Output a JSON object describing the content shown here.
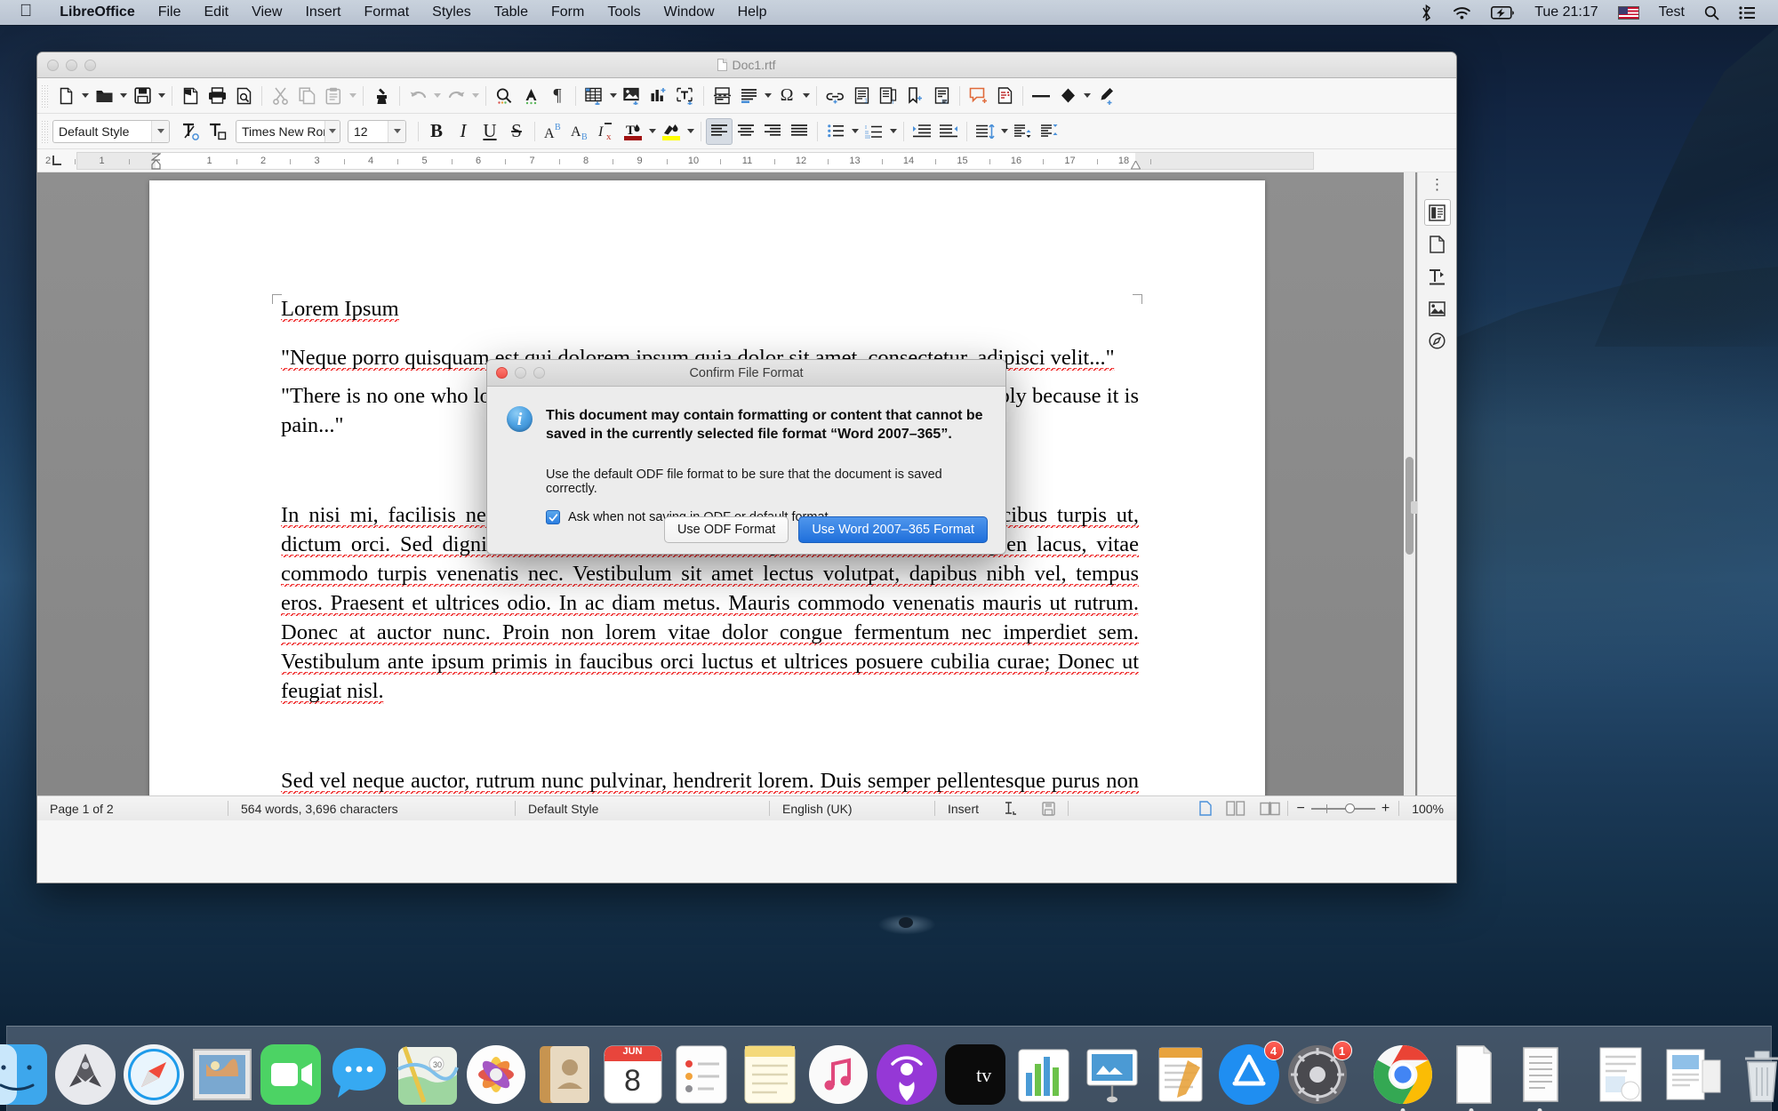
{
  "menubar": {
    "apple_icon": "apple-logo-icon",
    "items": [
      {
        "label": "LibreOffice",
        "bold": true
      },
      {
        "label": "File"
      },
      {
        "label": "Edit"
      },
      {
        "label": "View"
      },
      {
        "label": "Insert"
      },
      {
        "label": "Format"
      },
      {
        "label": "Styles"
      },
      {
        "label": "Table"
      },
      {
        "label": "Form"
      },
      {
        "label": "Tools"
      },
      {
        "label": "Window"
      },
      {
        "label": "Help"
      }
    ],
    "status": {
      "bluetooth_icon": "bluetooth-icon",
      "wifi_icon": "wifi-icon",
      "battery_icon": "battery-charging-icon",
      "clock": "Tue 21:17",
      "flag_icon": "us-flag-icon",
      "user": "Test",
      "search_icon": "spotlight-search-icon",
      "control_center_icon": "control-center-icon"
    }
  },
  "window": {
    "title": "Doc1.rtf",
    "file_icon": "rtf-document-icon"
  },
  "standard_toolbar": [
    {
      "name": "new-document",
      "icon": "new-doc-icon",
      "dropdown": true,
      "dim": false
    },
    {
      "name": "open-document",
      "icon": "open-folder-icon",
      "dropdown": true,
      "dim": false
    },
    {
      "name": "save-document",
      "icon": "save-floppy-icon",
      "dropdown": true,
      "dim": false
    },
    {
      "sep": true
    },
    {
      "name": "export-pdf",
      "icon": "export-pdf-icon",
      "dim": false
    },
    {
      "name": "print",
      "icon": "printer-icon",
      "dim": false
    },
    {
      "name": "print-preview",
      "icon": "print-preview-icon",
      "dim": false
    },
    {
      "sep": true
    },
    {
      "name": "cut",
      "icon": "scissors-icon",
      "dim": true
    },
    {
      "name": "copy",
      "icon": "copy-icon",
      "dim": true
    },
    {
      "name": "paste",
      "icon": "clipboard-icon",
      "dropdown": true,
      "dim": true
    },
    {
      "sep": true
    },
    {
      "name": "clone-formatting",
      "icon": "paintbrush-clone-icon",
      "dim": false
    },
    {
      "sep": true
    },
    {
      "name": "undo",
      "icon": "undo-arrow-icon",
      "dropdown": true,
      "dim": true
    },
    {
      "name": "redo",
      "icon": "redo-arrow-icon",
      "dropdown": true,
      "dim": true
    },
    {
      "sep": true
    },
    {
      "name": "find-and-replace",
      "icon": "magnifier-icon",
      "dim": false
    },
    {
      "name": "spelling",
      "icon": "spellcheck-abc-icon",
      "dim": false
    },
    {
      "name": "formatting-marks",
      "icon": "pilcrow-icon",
      "dim": false
    },
    {
      "sep": true
    },
    {
      "name": "insert-table",
      "icon": "table-grid-icon",
      "dropdown": true,
      "dim": false
    },
    {
      "name": "insert-image",
      "icon": "image-icon",
      "dim": false
    },
    {
      "name": "insert-chart",
      "icon": "bar-chart-icon",
      "dim": false
    },
    {
      "name": "insert-text-box",
      "icon": "text-box-icon",
      "dim": false
    },
    {
      "sep": true
    },
    {
      "name": "insert-page-break",
      "icon": "page-break-icon",
      "dim": false
    },
    {
      "name": "insert-field",
      "icon": "field-lines-icon",
      "dropdown": true,
      "dim": false
    },
    {
      "name": "insert-special-character",
      "icon": "omega-icon",
      "dropdown": true,
      "dim": false
    },
    {
      "sep": true
    },
    {
      "name": "insert-hyperlink",
      "icon": "hyperlink-icon",
      "dim": false
    },
    {
      "name": "insert-footnote",
      "icon": "footnote-icon",
      "dim": false
    },
    {
      "name": "insert-endnote",
      "icon": "endnote-icon",
      "dim": false
    },
    {
      "name": "insert-bookmark",
      "icon": "bookmark-icon",
      "dim": false
    },
    {
      "name": "insert-cross-reference",
      "icon": "cross-reference-icon",
      "dim": false
    },
    {
      "sep": true
    },
    {
      "name": "insert-comment",
      "icon": "comment-icon",
      "dim": false
    },
    {
      "name": "track-changes",
      "icon": "track-changes-icon",
      "dim": false
    },
    {
      "sep": true
    },
    {
      "name": "insert-line",
      "icon": "line-icon",
      "dim": false
    },
    {
      "name": "basic-shapes",
      "icon": "shapes-diamond-icon",
      "dropdown": true,
      "dim": false
    },
    {
      "name": "show-draw-functions",
      "icon": "draw-brush-icon",
      "dim": false
    }
  ],
  "formatting_toolbar": {
    "paragraph_style": {
      "value": "Default Style",
      "placeholder": "Paragraph Style"
    },
    "font_name": {
      "value": "Times New Rom",
      "placeholder": "Font Name"
    },
    "font_size": {
      "value": "12",
      "placeholder": "Font Size"
    },
    "buttons": [
      {
        "name": "update-selected-style",
        "icon": "update-style-icon"
      },
      {
        "name": "new-style-from-selection",
        "icon": "new-style-icon"
      },
      {
        "name": "bold",
        "icon": "bold-icon",
        "glyph": "B"
      },
      {
        "name": "italic",
        "icon": "italic-icon",
        "glyph": "I"
      },
      {
        "name": "underline",
        "icon": "underline-icon",
        "glyph": "U"
      },
      {
        "name": "strikethrough",
        "icon": "strikethrough-icon",
        "glyph": "S"
      },
      {
        "name": "superscript",
        "icon": "superscript-icon"
      },
      {
        "name": "subscript",
        "icon": "subscript-icon"
      },
      {
        "name": "clear-formatting",
        "icon": "clear-formatting-icon"
      },
      {
        "name": "font-color",
        "icon": "font-color-icon",
        "color": "#a01010"
      },
      {
        "name": "highlight-color",
        "icon": "highlight-color-icon",
        "color": "#ffff00"
      },
      {
        "name": "align-left",
        "icon": "align-left-icon",
        "active": true
      },
      {
        "name": "align-center",
        "icon": "align-center-icon"
      },
      {
        "name": "align-right",
        "icon": "align-right-icon"
      },
      {
        "name": "justified",
        "icon": "align-justify-icon"
      },
      {
        "name": "unordered-list",
        "icon": "bullet-list-icon"
      },
      {
        "name": "ordered-list",
        "icon": "numbered-list-icon"
      },
      {
        "name": "increase-indent",
        "icon": "increase-indent-icon"
      },
      {
        "name": "decrease-indent",
        "icon": "decrease-indent-icon"
      },
      {
        "name": "line-spacing",
        "icon": "line-spacing-icon"
      },
      {
        "name": "paragraph-space-above",
        "icon": "space-above-paragraph-icon"
      },
      {
        "name": "paragraph-space-below",
        "icon": "space-below-paragraph-icon"
      }
    ]
  },
  "ruler": {
    "corner_icon": "tab-stop-left-icon",
    "labels": [
      "2",
      "1",
      "1",
      "2",
      "3",
      "4",
      "5",
      "6",
      "7",
      "8",
      "9",
      "10",
      "11",
      "12",
      "13",
      "14",
      "15",
      "16",
      "17",
      "18"
    ]
  },
  "sidebar_rail": {
    "more_icon": "sidebar-settings-dots-icon",
    "items": [
      {
        "name": "sidebar-properties",
        "icon": "properties-panel-icon",
        "selected": true
      },
      {
        "name": "sidebar-page",
        "icon": "page-panel-icon"
      },
      {
        "name": "sidebar-styles",
        "icon": "styles-panel-icon"
      },
      {
        "name": "sidebar-gallery",
        "icon": "gallery-panel-icon"
      },
      {
        "name": "sidebar-navigator",
        "icon": "navigator-compass-icon"
      }
    ]
  },
  "document": {
    "title": "Lorem Ipsum",
    "paragraphs": [
      "\"Neque porro quisquam est qui dolorem ipsum quia dolor sit amet, consectetur, adipisci velit...\"",
      "\"There is no one who loves pain itself, who seeks after it and wants to have it, simply because it is pain...\"",
      "In nisi mi, facilisis nec sollicitudin at, tristique eu ante. Vivamus fringilla faucibus turpis ut, dictum orci. Sed dignissim metus et mi rhoncus semper. Praesent lobortis sapien lacus, vitae commodo turpis venenatis nec. Vestibulum sit amet lectus volutpat, dapibus nibh vel, tempus eros. Praesent et ultrices odio. In ac diam metus. Mauris commodo venenatis mauris ut rutrum. Donec at auctor nunc. Proin non lorem vitae dolor congue fermentum nec imperdiet sem. Vestibulum ante ipsum primis in faucibus orci luctus et ultrices posuere cubilia curae; Donec ut feugiat nisl.",
      "Sed vel neque auctor, rutrum nunc pulvinar, hendrerit lorem. Duis semper pellentesque purus non convallis. Nunc hendrerit accumsan dui, vitae vestibulum ipsum suscipit a. Phasellus cursus eget"
    ]
  },
  "statusbar": {
    "page": "Page 1 of 2",
    "words": "564 words, 3,696 characters",
    "style": "Default Style",
    "language": "English (UK)",
    "insert_mode": "Insert",
    "selection_icon": "selection-mode-icon",
    "save_icon": "unsaved-changes-icon",
    "view_single_icon": "single-page-view-icon",
    "view_multi_icon": "multi-page-view-icon",
    "view_book_icon": "book-view-icon",
    "zoom_out": "−",
    "zoom_in": "+",
    "zoom_level": "100%"
  },
  "dialog": {
    "title": "Confirm File Format",
    "info_icon": "info-circle-icon",
    "info_glyph": "i",
    "primary_text": "This document may contain formatting or content that cannot be saved in the currently selected file format “Word 2007–365”.",
    "secondary_text": "Use the default ODF file format to be sure that the document is saved correctly.",
    "checkbox": {
      "label": "Ask when not saving in ODF or default format",
      "checked": true
    },
    "buttons": {
      "secondary": "Use ODF Format",
      "primary": "Use Word 2007–365 Format"
    }
  },
  "dock": {
    "items": [
      {
        "name": "finder",
        "icon": "finder-icon"
      },
      {
        "name": "launchpad",
        "icon": "launchpad-icon"
      },
      {
        "name": "safari",
        "icon": "safari-compass-icon"
      },
      {
        "name": "mail",
        "icon": "mail-stamp-icon"
      },
      {
        "name": "facetime",
        "icon": "facetime-camera-icon"
      },
      {
        "name": "messages",
        "icon": "messages-bubble-icon"
      },
      {
        "name": "maps",
        "icon": "maps-icon"
      },
      {
        "name": "photos",
        "icon": "photos-pinwheel-icon"
      },
      {
        "name": "contacts",
        "icon": "contacts-book-icon"
      },
      {
        "name": "calendar",
        "icon": "calendar-icon",
        "month": "JUN",
        "day": "8"
      },
      {
        "name": "reminders",
        "icon": "reminders-list-icon"
      },
      {
        "name": "notes",
        "icon": "notes-icon"
      },
      {
        "name": "itunes",
        "icon": "itunes-note-icon"
      },
      {
        "name": "podcasts",
        "icon": "podcasts-icon"
      },
      {
        "name": "apple-tv",
        "icon": "apple-tv-icon"
      },
      {
        "name": "numbers",
        "icon": "numbers-chart-icon"
      },
      {
        "name": "keynote",
        "icon": "keynote-podium-icon"
      },
      {
        "name": "pages",
        "icon": "pages-document-icon"
      },
      {
        "name": "app-store",
        "icon": "app-store-icon",
        "badge": "4"
      },
      {
        "name": "system-preferences",
        "icon": "system-preferences-gear-icon",
        "badge": "1"
      },
      {
        "sep": true
      },
      {
        "name": "google-chrome",
        "icon": "chrome-icon",
        "running": true
      },
      {
        "name": "libreoffice-writer",
        "icon": "libreoffice-writer-doc-icon",
        "running": true
      },
      {
        "name": "text-edit",
        "icon": "textedit-icon",
        "running": true
      },
      {
        "sep": true
      },
      {
        "name": "downloads-stack",
        "icon": "downloads-stack-icon"
      },
      {
        "name": "documents-stack",
        "icon": "documents-stack-icon"
      },
      {
        "name": "trash",
        "icon": "trash-icon"
      }
    ]
  }
}
